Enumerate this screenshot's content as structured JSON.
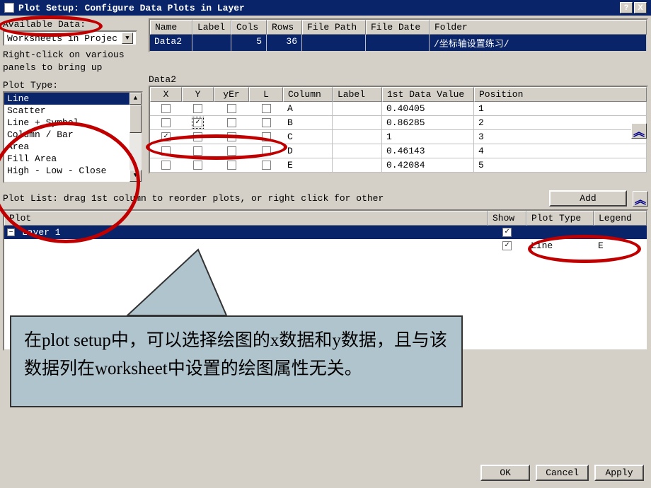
{
  "titlebar": {
    "title": "Plot Setup: Configure Data Plots in Layer",
    "help": "?",
    "close": "X"
  },
  "available": {
    "label": "Available Data:",
    "dropdown": "Worksheets in Projec",
    "hint": "Right-click on various panels to bring up"
  },
  "plotType": {
    "label": "Plot Type:",
    "items": [
      "Line",
      "Scatter",
      "Line + Symbol",
      "Column / Bar",
      "Area",
      "Fill Area",
      "High - Low - Close"
    ]
  },
  "dataGrid": {
    "headers": {
      "name": "Name",
      "label": "Label",
      "cols": "Cols",
      "rows": "Rows",
      "filepath": "File Path",
      "filedate": "File Date",
      "folder": "Folder"
    },
    "row": {
      "name": "Data2",
      "label": "",
      "cols": "5",
      "rows": "36",
      "filepath": "",
      "filedate": "",
      "folder": "/坐标轴设置练习/"
    }
  },
  "colGrid": {
    "title": "Data2",
    "headers": {
      "x": "X",
      "y": "Y",
      "yer": "yEr",
      "l": "L",
      "column": "Column",
      "label": "Label",
      "first": "1st Data Value",
      "position": "Position"
    },
    "rows": [
      {
        "column": "A",
        "first": "0.40405",
        "position": "1"
      },
      {
        "column": "B",
        "first": "0.86285",
        "position": "2"
      },
      {
        "column": "C",
        "first": "1",
        "position": "3"
      },
      {
        "column": "D",
        "first": "0.46143",
        "position": "4"
      },
      {
        "column": "E",
        "first": "0.42084",
        "position": "5"
      }
    ]
  },
  "plotList": {
    "hint": "Plot List: drag 1st column to reorder plots, or right click for other",
    "addBtn": "Add",
    "headers": {
      "plot": "Plot",
      "show": "Show",
      "plottype": "Plot Type",
      "legend": "Legend"
    },
    "layer": "Layer 1",
    "row2": {
      "plottype": "Line",
      "legend": "E"
    }
  },
  "footer": {
    "ok": "OK",
    "cancel": "Cancel",
    "apply": "Apply"
  },
  "callout": "在plot setup中，可以选择绘图的x数据和y数据，且与该数据列在worksheet中设置的绘图属性无关。"
}
